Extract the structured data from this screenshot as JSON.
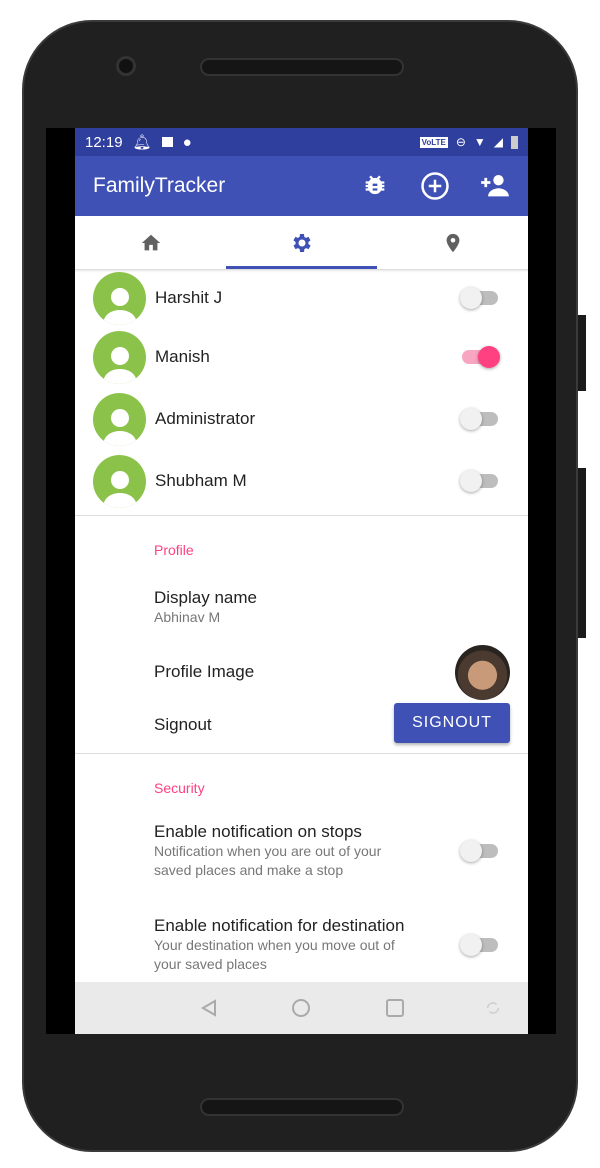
{
  "status_bar": {
    "time": "12:19",
    "network": "VoLTE"
  },
  "app_bar": {
    "title": "FamilyTracker",
    "actions": [
      "bug-icon",
      "add-circle-icon",
      "add-person-icon"
    ]
  },
  "tabs": [
    {
      "icon": "home-icon"
    },
    {
      "icon": "gear-icon",
      "active": true
    },
    {
      "icon": "location-pin-icon"
    }
  ],
  "members": [
    {
      "name": "Harshit J",
      "enabled": false
    },
    {
      "name": "Manish",
      "enabled": true
    },
    {
      "name": "Administrator",
      "enabled": false
    },
    {
      "name": "Shubham M",
      "enabled": false
    }
  ],
  "profile": {
    "header": "Profile",
    "display_name_label": "Display name",
    "display_name_value": "Abhinav M",
    "profile_image_label": "Profile Image",
    "signout_label": "Signout",
    "signout_button": "SIGNOUT"
  },
  "security": {
    "header": "Security",
    "items": [
      {
        "title": "Enable notification on stops",
        "summary": "Notification when you are out of your saved places and make a stop",
        "enabled": false
      },
      {
        "title": "Enable notification for destination",
        "summary": "Your destination when you move out of your saved places",
        "enabled": false
      }
    ]
  },
  "colors": {
    "primary": "#3f51b5",
    "accent": "#ff4081",
    "avatar": "#8bc34a"
  }
}
